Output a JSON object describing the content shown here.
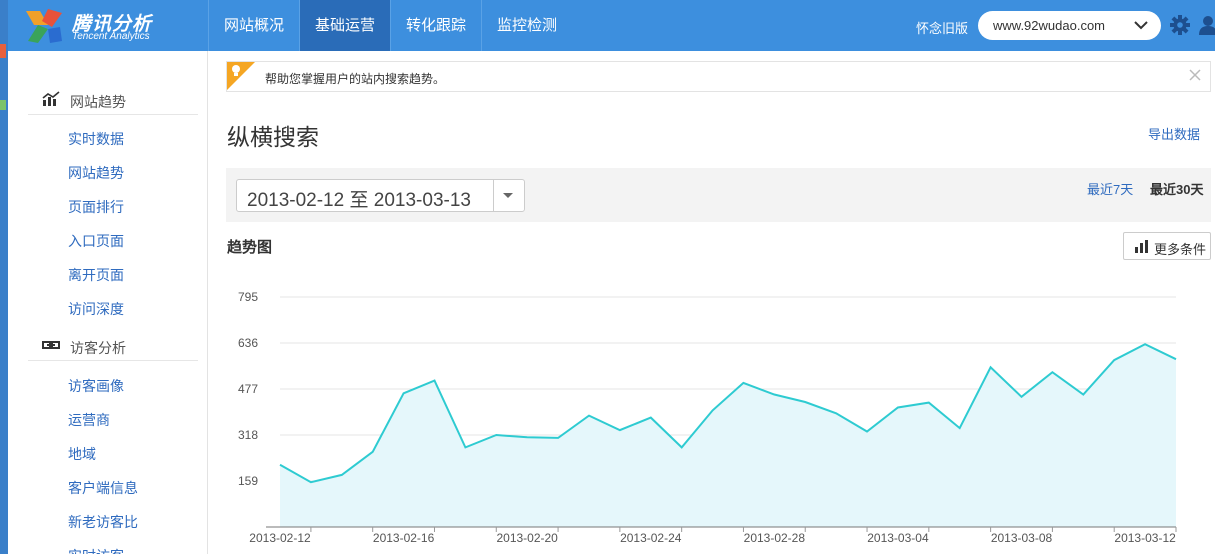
{
  "brand": {
    "title": "腾讯分析",
    "subtitle": "Tencent Analytics"
  },
  "nav": {
    "items": [
      "网站概况",
      "基础运营",
      "转化跟踪",
      "监控检测"
    ],
    "active_index": 1
  },
  "header": {
    "old_version_label": "怀念旧版",
    "site_value": "www.92wudao.com"
  },
  "sidebar": {
    "sections": [
      {
        "title": "网站趋势",
        "icon": "trend-chart-icon",
        "items": [
          "实时数据",
          "网站趋势",
          "页面排行",
          "入口页面",
          "离开页面",
          "访问深度"
        ]
      },
      {
        "title": "访客分析",
        "icon": "link-icon",
        "items": [
          "访客画像",
          "运营商",
          "地域",
          "客户端信息",
          "新老访客比",
          "实时访客"
        ]
      }
    ]
  },
  "notice": {
    "text": "帮助您掌握用户的站内搜索趋势。"
  },
  "page": {
    "title": "纵横搜索",
    "export_label": "导出数据"
  },
  "date_range": {
    "start": "2013-02-12",
    "separator": "至",
    "end": "2013-03-13",
    "quick_7": "最近7天",
    "quick_30": "最近30天",
    "selected": "quick_30"
  },
  "trend": {
    "title": "趋势图",
    "more_label": "更多条件"
  },
  "colors": {
    "topbar": "#3d8fde",
    "nav_active": "#2a6cb8",
    "link": "#2f6bbf",
    "line": "#2ecbd1",
    "area": "#e5f7fb"
  },
  "chart_data": {
    "type": "area",
    "title": "",
    "xlabel": "",
    "ylabel": "",
    "ylim": [
      0,
      795
    ],
    "y_ticks": [
      159,
      318,
      477,
      636,
      795
    ],
    "grid": true,
    "x": [
      "2013-02-12",
      "2013-02-13",
      "2013-02-14",
      "2013-02-15",
      "2013-02-16",
      "2013-02-17",
      "2013-02-18",
      "2013-02-19",
      "2013-02-20",
      "2013-02-21",
      "2013-02-22",
      "2013-02-23",
      "2013-02-24",
      "2013-02-25",
      "2013-02-26",
      "2013-02-27",
      "2013-02-28",
      "2013-03-01",
      "2013-03-02",
      "2013-03-03",
      "2013-03-04",
      "2013-03-05",
      "2013-03-06",
      "2013-03-07",
      "2013-03-08",
      "2013-03-09",
      "2013-03-10",
      "2013-03-11",
      "2013-03-12",
      "2013-03-13"
    ],
    "x_tick_labels": [
      "2013-02-12",
      "2013-02-16",
      "2013-02-20",
      "2013-02-24",
      "2013-02-28",
      "2013-03-04",
      "2013-03-08",
      "2013-03-12"
    ],
    "series": [
      {
        "values": [
          215,
          155,
          180,
          260,
          462,
          506,
          275,
          318,
          310,
          308,
          385,
          335,
          378,
          275,
          403,
          498,
          458,
          432,
          393,
          330,
          413,
          430,
          342,
          552,
          450,
          535,
          458,
          577,
          632,
          580
        ]
      }
    ]
  }
}
